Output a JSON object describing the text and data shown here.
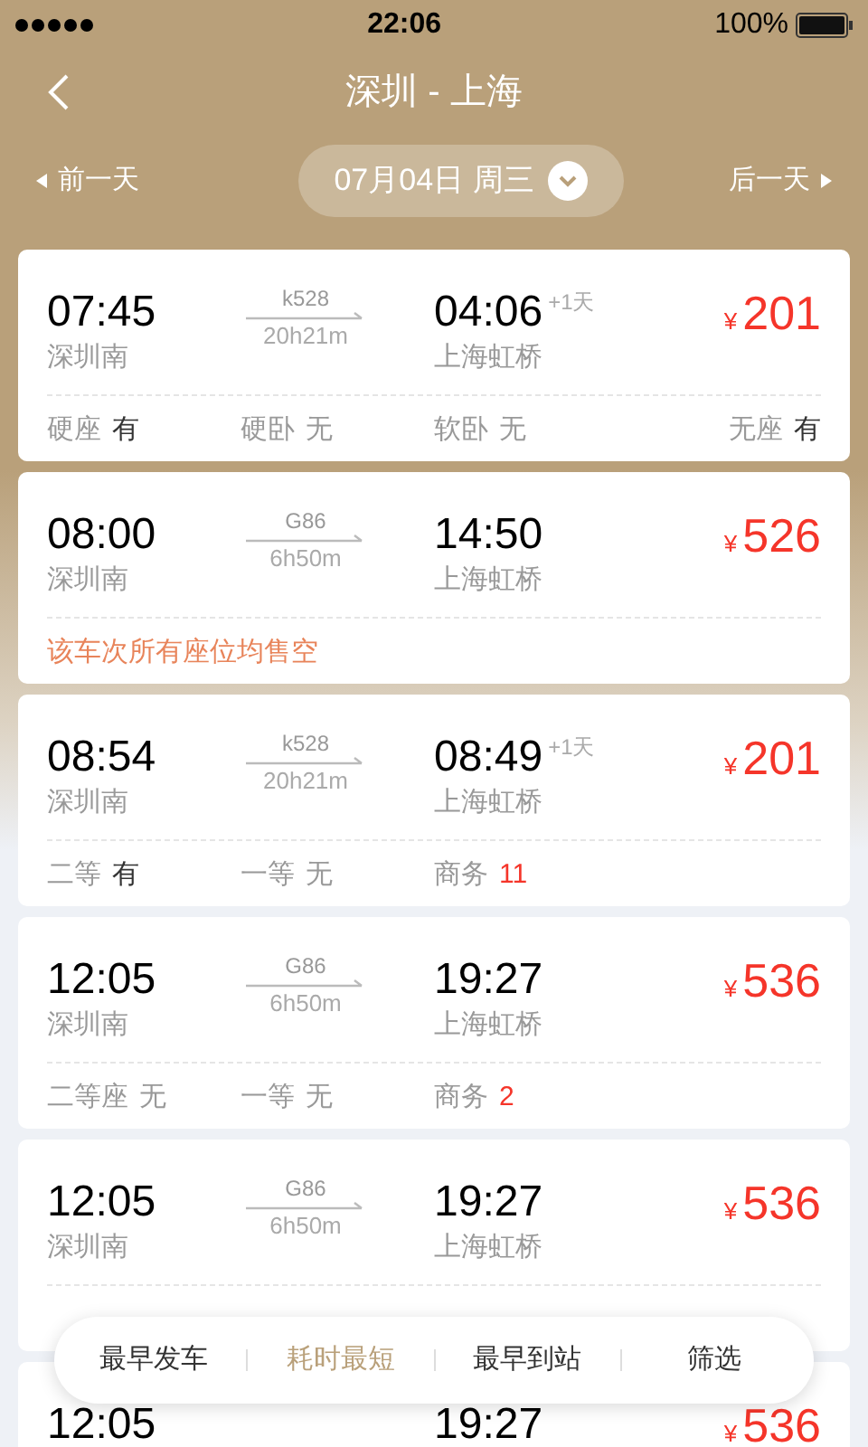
{
  "status_bar": {
    "time": "22:06",
    "battery": "100%"
  },
  "header": {
    "title": "深圳 - 上海",
    "prev_day": "前一天",
    "date": "07月04日 周三",
    "next_day": "后一天"
  },
  "trains": [
    {
      "depart_time": "07:45",
      "depart_station": "深圳南",
      "train_no": "k528",
      "duration": "20h21m",
      "arrive_time": "04:06",
      "next_day": "+1天",
      "arrive_station": "上海虹桥",
      "currency": "¥",
      "price": "201",
      "seats": [
        {
          "class": "硬座",
          "value": "有",
          "kind": "available"
        },
        {
          "class": "硬卧",
          "value": "无",
          "kind": "none"
        },
        {
          "class": "软卧",
          "value": "无",
          "kind": "none"
        },
        {
          "class": "无座",
          "value": "有",
          "kind": "available"
        }
      ]
    },
    {
      "depart_time": "08:00",
      "depart_station": "深圳南",
      "train_no": "G86",
      "duration": "6h50m",
      "arrive_time": "14:50",
      "arrive_station": "上海虹桥",
      "currency": "¥",
      "price": "526",
      "notice": "该车次所有座位均售空"
    },
    {
      "depart_time": "08:54",
      "depart_station": "深圳南",
      "train_no": "k528",
      "duration": "20h21m",
      "arrive_time": "08:49",
      "next_day": "+1天",
      "arrive_station": "上海虹桥",
      "currency": "¥",
      "price": "201",
      "seats": [
        {
          "class": "二等",
          "value": "有",
          "kind": "available"
        },
        {
          "class": "一等",
          "value": "无",
          "kind": "none"
        },
        {
          "class": "商务",
          "value": "11",
          "kind": "limited"
        }
      ]
    },
    {
      "depart_time": "12:05",
      "depart_station": "深圳南",
      "train_no": "G86",
      "duration": "6h50m",
      "arrive_time": "19:27",
      "arrive_station": "上海虹桥",
      "currency": "¥",
      "price": "536",
      "seats": [
        {
          "class": "二等座",
          "value": "无",
          "kind": "none"
        },
        {
          "class": "一等",
          "value": "无",
          "kind": "none"
        },
        {
          "class": "商务",
          "value": "2",
          "kind": "limited"
        }
      ]
    },
    {
      "depart_time": "12:05",
      "depart_station": "深圳南",
      "train_no": "G86",
      "duration": "6h50m",
      "arrive_time": "19:27",
      "arrive_station": "上海虹桥",
      "currency": "¥",
      "price": "536"
    },
    {
      "depart_time": "12:05",
      "arrive_time": "19:27",
      "currency": "¥",
      "price": "536"
    }
  ],
  "sort_bar": [
    {
      "label": "最早发车",
      "selected": false
    },
    {
      "label": "耗时最短",
      "selected": true
    },
    {
      "label": "最早到站",
      "selected": false
    },
    {
      "label": "筛选",
      "selected": false
    }
  ]
}
